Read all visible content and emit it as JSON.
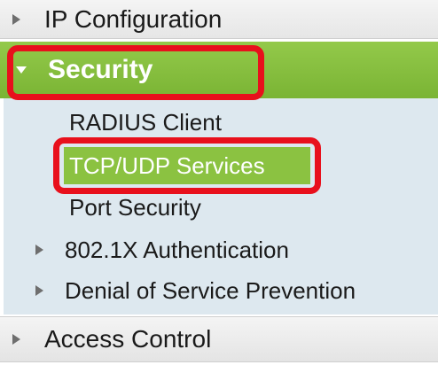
{
  "nav": {
    "ip_configuration": "IP Configuration",
    "security": "Security",
    "security_children": {
      "radius_client": "RADIUS Client",
      "tcp_udp_services": "TCP/UDP Services",
      "port_security": "Port Security",
      "dot1x_authentication": "802.1X Authentication",
      "denial_of_service_prevention": "Denial of Service Prevention"
    },
    "access_control": "Access Control"
  },
  "icons": {
    "collapsed": "triangle-right-icon",
    "expanded": "triangle-down-icon"
  },
  "colors": {
    "selected_green": "#8bc241",
    "highlight_red": "#e8101c",
    "submenu_bg": "#dde8ef"
  }
}
